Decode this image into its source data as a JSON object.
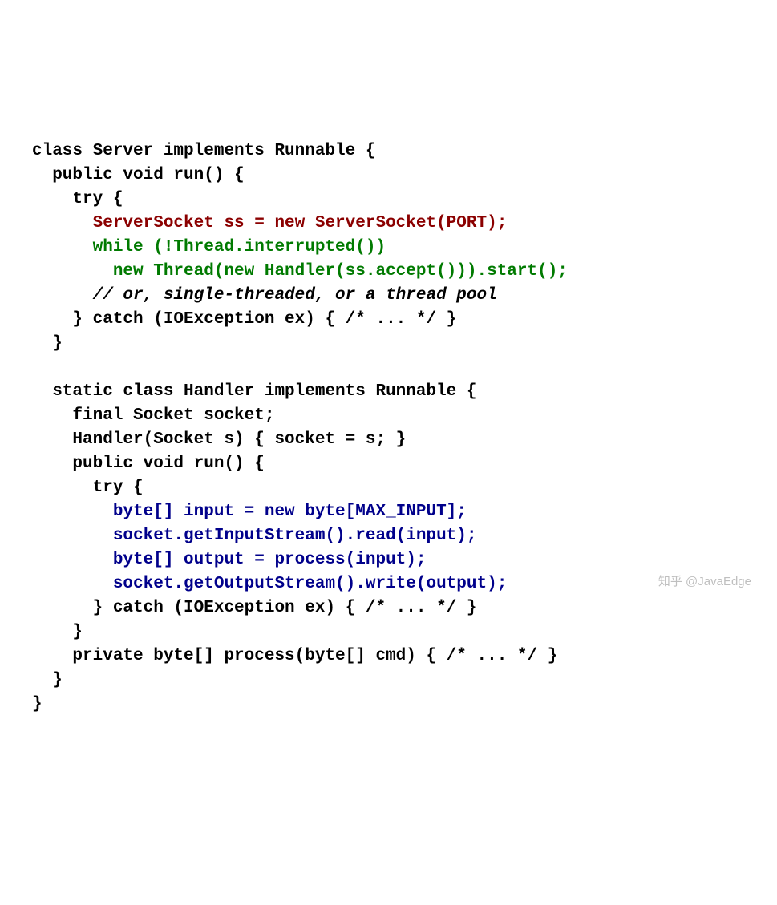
{
  "code": {
    "l01": "class Server implements Runnable {",
    "l02": "  public void run() {",
    "l03": "    try {",
    "l04": "      ServerSocket ss = new ServerSocket(PORT);",
    "l05a": "      while (!Thread.interrupted())",
    "l05b": "        new Thread(new Handler(ss.accept())).start();",
    "l06": "      // or, single-threaded, or a thread pool",
    "l07": "    } catch (IOException ex) { /* ... */ }",
    "l08": "  }",
    "l09": "",
    "l10": "  static class Handler implements Runnable {",
    "l11": "    final Socket socket;",
    "l12": "    Handler(Socket s) { socket = s; }",
    "l13": "    public void run() {",
    "l14": "      try {",
    "l15": "        byte[] input = new byte[MAX_INPUT];",
    "l16": "        socket.getInputStream().read(input);",
    "l17": "        byte[] output = process(input);",
    "l18": "        socket.getOutputStream().write(output);",
    "l19": "      } catch (IOException ex) { /* ... */ }",
    "l20": "    }",
    "l21": "    private byte[] process(byte[] cmd) { /* ... */ }",
    "l22": "  }",
    "l23": "}"
  },
  "watermark": "知乎 @JavaEdge"
}
